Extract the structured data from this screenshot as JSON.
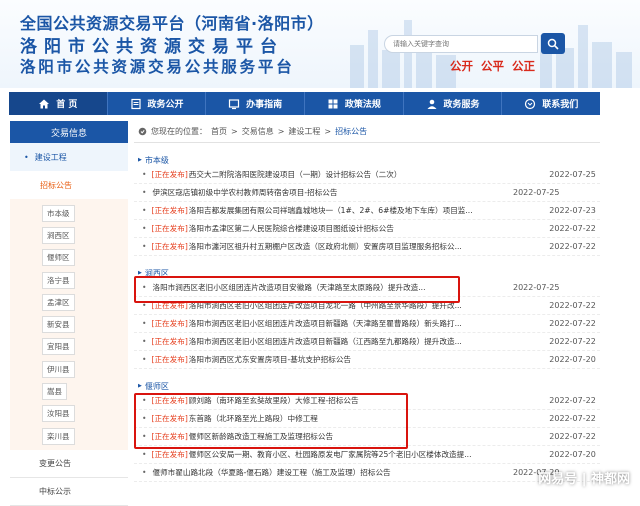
{
  "header": {
    "title_line1": "全国公共资源交易平台（河南省·洛阳市）",
    "title_line2": "洛阳市公共资源交易平台",
    "title_line3": "洛阳市公共资源交易公共服务平台",
    "search_placeholder": "请输入关键字查询",
    "slogans": [
      "公开",
      "公平",
      "公正"
    ],
    "brand_color": "#1b56a6",
    "slogan_color": "#d92a1c"
  },
  "nav": {
    "items": [
      {
        "label": "首  页",
        "icon": "home-icon"
      },
      {
        "label": "政务公开",
        "icon": "doc-icon"
      },
      {
        "label": "办事指南",
        "icon": "guide-icon"
      },
      {
        "label": "政策法规",
        "icon": "law-icon"
      },
      {
        "label": "政务服务",
        "icon": "service-icon"
      },
      {
        "label": "联系我们",
        "icon": "contact-icon"
      }
    ]
  },
  "sidebar": {
    "heading": "交易信息",
    "category": "建设工程",
    "subcategory": "招标公告",
    "regions": [
      "市本级",
      "涧西区",
      "偃师区",
      "洛宁县",
      "孟津区",
      "新安县",
      "宜阳县",
      "伊川县",
      "嵩县",
      "汝阳县",
      "栾川县"
    ],
    "tail": [
      "变更公告",
      "中标公示"
    ]
  },
  "breadcrumb": {
    "prefix": "您现在的位置：",
    "items": [
      "首页",
      "交易信息",
      "建设工程",
      "招标公告"
    ],
    "separator": ">"
  },
  "sections": [
    {
      "name": "市本级",
      "rows": [
        {
          "tag": "[正在发布]",
          "title": "西交大二附院洛阳医院建设项目（一期）设计招标公告（二次）",
          "date": "2022-07-25"
        },
        {
          "tag": "",
          "title": "伊滨区寇店镇初级中学农村教师周转宿舍项目-招标公告",
          "date": "2022-07-25"
        },
        {
          "tag": "[正在发布]",
          "title": "洛阳吉都发展集团有限公司祥瑞鑫城地块一（1#、2#、6#楼及地下车库）项目监...",
          "date": "2022-07-23"
        },
        {
          "tag": "[正在发布]",
          "title": "洛阳市孟津区第二人民医院综合楼建设项目图纸设计招标公告",
          "date": "2022-07-22"
        },
        {
          "tag": "[正在发布]",
          "title": "洛阳市瀍河区祖升村五期棚户区改造（区政府北侧）安置房项目监理服务招标公...",
          "date": "2022-07-22"
        }
      ]
    },
    {
      "name": "涧西区",
      "rows": [
        {
          "tag": "",
          "title": "洛阳市涧西区老旧小区组团连片改造项目安徽路（天津路至太原路段）提升改造...",
          "date": "2022-07-25"
        },
        {
          "tag": "[正在发布]",
          "title": "洛阳市涧西区老旧小区组团连片改造项目龙北一路（中州路至景华路段）提升改...",
          "date": "2022-07-22"
        },
        {
          "tag": "[正在发布]",
          "title": "洛阳市涧西区老旧小区组团连片改造项目新疆路（天津路至瞿曹路段）新头路打...",
          "date": "2022-07-22"
        },
        {
          "tag": "[正在发布]",
          "title": "洛阳市涧西区老旧小区组团连片改造项目新疆路（江西路至九都路段）提升改造...",
          "date": "2022-07-22"
        },
        {
          "tag": "[正在发布]",
          "title": "洛阳市涧西区尤东安置房项目-基坑支护招标公告",
          "date": "2022-07-20"
        }
      ]
    },
    {
      "name": "偃师区",
      "rows": [
        {
          "tag": "[正在发布]",
          "title": "顾刘路（南环路至玄奘故里段）大修工程-招标公告",
          "date": "2022-07-22"
        },
        {
          "tag": "[正在发布]",
          "title": "东首路（北环路至光上路段）中修工程",
          "date": "2022-07-22"
        },
        {
          "tag": "[正在发布]",
          "title": "偃师区新龄路改造工程施工及监理招标公告",
          "date": "2022-07-22"
        },
        {
          "tag": "[正在发布]",
          "title": "偃师区公安局一期、教育小区、杜园路原发电厂家属院等25个老旧小区楼体改造提...",
          "date": "2022-07-20"
        },
        {
          "tag": "",
          "title": "偃师市翟山路北段（华夏路-偃石路）建设工程（施工及监理）招标公告",
          "date": "2022-07-20"
        }
      ]
    }
  ],
  "watermark": "网易号 | 神都网"
}
